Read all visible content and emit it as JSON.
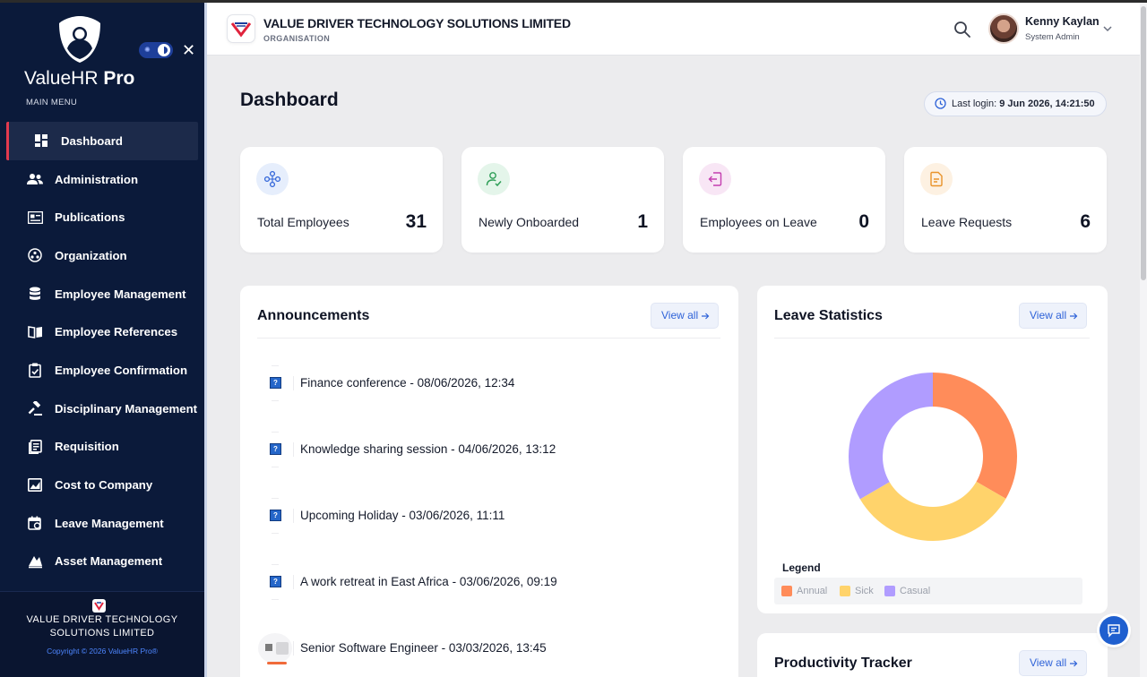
{
  "sidebar": {
    "brand_prefix": "ValueHR",
    "brand_suffix": " Pro",
    "menu_title": "MAIN MENU",
    "items": [
      {
        "label": "Dashboard",
        "icon": "dashboard-icon",
        "active": true
      },
      {
        "label": "Administration",
        "icon": "users-icon"
      },
      {
        "label": "Publications",
        "icon": "id-card-icon"
      },
      {
        "label": "Organization",
        "icon": "organization-icon"
      },
      {
        "label": "Employee Management",
        "icon": "database-icon"
      },
      {
        "label": "Employee References",
        "icon": "book-icon"
      },
      {
        "label": "Employee Confirmation",
        "icon": "clipboard-check-icon"
      },
      {
        "label": "Disciplinary Management",
        "icon": "gavel-icon"
      },
      {
        "label": "Requisition",
        "icon": "clipboard-list-icon"
      },
      {
        "label": "Cost to Company",
        "icon": "chart-image-icon"
      },
      {
        "label": "Leave Management",
        "icon": "calendar-icon"
      },
      {
        "label": "Asset Management",
        "icon": "asset-icon"
      }
    ],
    "footer_company_line1": "VALUE DRIVER TECHNOLOGY",
    "footer_company_line2": "SOLUTIONS LIMITED",
    "copyright": "Copyright © 2026 ValueHR Pro®"
  },
  "header": {
    "org_name": "VALUE DRIVER TECHNOLOGY SOLUTIONS LIMITED",
    "org_subtitle": "ORGANISATION",
    "user_name": "Kenny Kaylan",
    "user_role": "System Admin"
  },
  "main": {
    "title": "Dashboard",
    "last_login_label": "Last login:",
    "last_login_value": "9 Jun 2026, 14:21:50",
    "stats": [
      {
        "label": "Total Employees",
        "value": "31",
        "icon": "employees-network-icon",
        "color": "#2f63d8",
        "bg": "#e6eefc"
      },
      {
        "label": "Newly Onboarded",
        "value": "1",
        "icon": "user-check-icon",
        "color": "#2e9e57",
        "bg": "#e4f5ea"
      },
      {
        "label": "Employees on Leave",
        "value": "0",
        "icon": "exit-door-icon",
        "color": "#c43fb0",
        "bg": "#f8e6f5"
      },
      {
        "label": "Leave Requests",
        "value": "6",
        "icon": "document-icon",
        "color": "#e9932a",
        "bg": "#fdf1e2"
      }
    ],
    "announcements": {
      "title": "Announcements",
      "view_all": "View all",
      "items": [
        {
          "text": "Finance conference - 08/06/2026, 12:34",
          "thumb": "question-icon"
        },
        {
          "text": "Knowledge sharing session - 04/06/2026, 13:12",
          "thumb": "question-icon"
        },
        {
          "text": "Upcoming Holiday - 03/06/2026, 11:11",
          "thumb": "question-icon"
        },
        {
          "text": "A work retreat in East Africa - 03/06/2026, 09:19",
          "thumb": "question-icon"
        },
        {
          "text": "Senior Software Engineer - 03/03/2026, 13:45",
          "thumb": "job-thumbnail"
        }
      ]
    },
    "leave_statistics": {
      "title": "Leave Statistics",
      "view_all": "View all",
      "legend_title": "Legend"
    },
    "productivity": {
      "title": "Productivity Tracker",
      "view_all": "View all"
    }
  },
  "chart_data": {
    "type": "pie",
    "categories": [
      "Annual",
      "Sick",
      "Casual"
    ],
    "values": [
      33.3,
      33.3,
      33.4
    ],
    "colors": [
      "#ff8c5a",
      "#ffd36b",
      "#b09cff"
    ],
    "donut": true,
    "legend_placement": "bottom"
  }
}
